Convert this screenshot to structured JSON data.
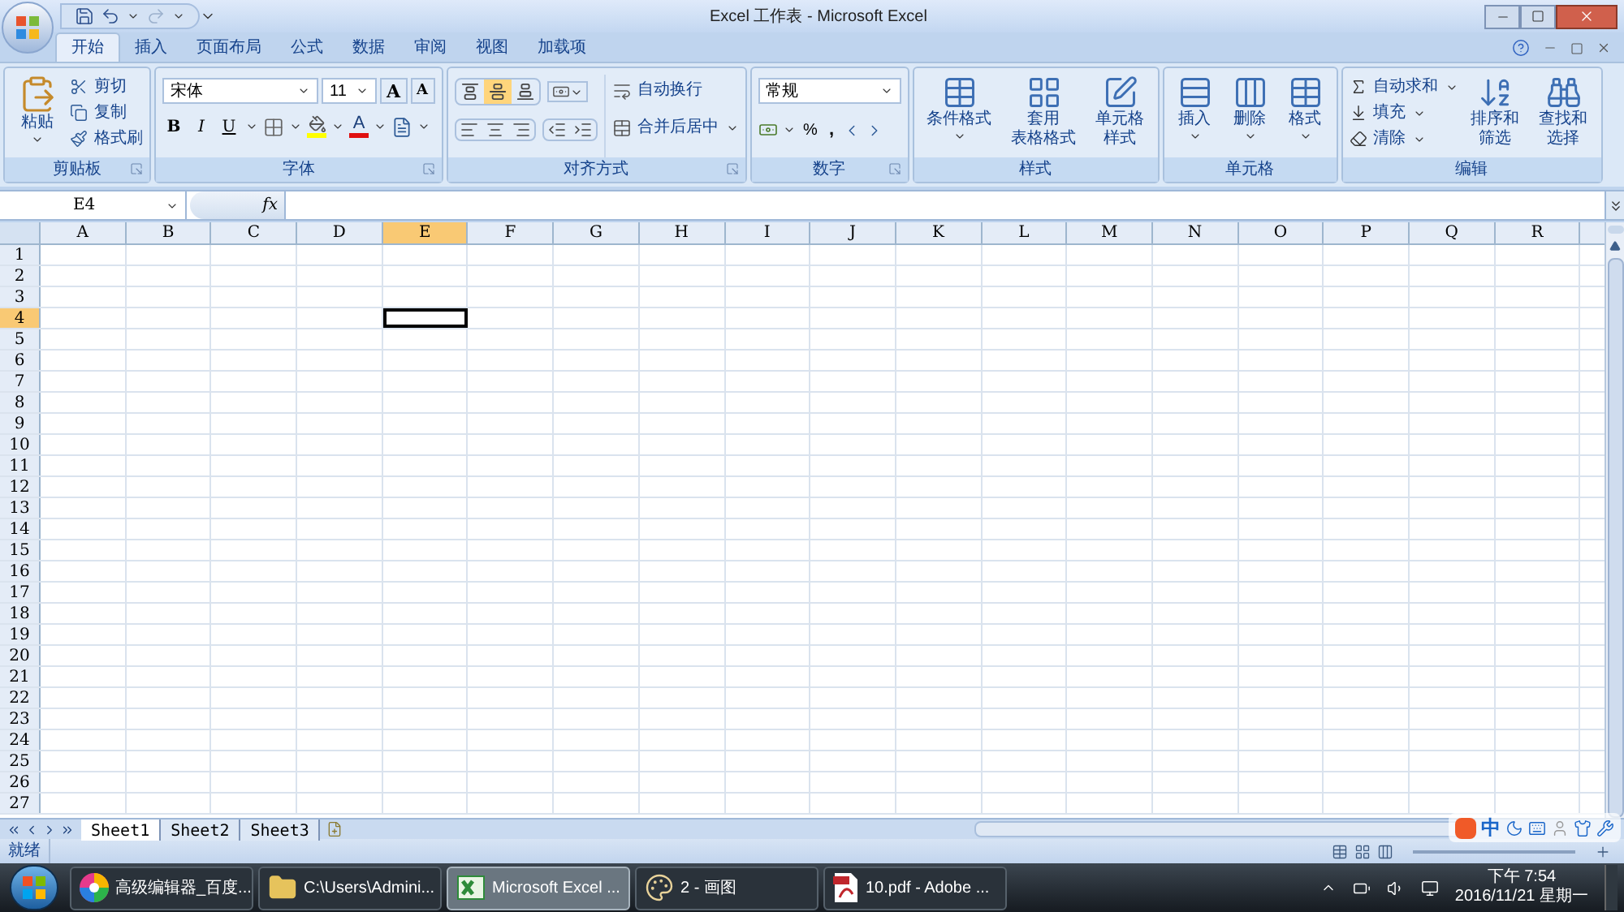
{
  "window": {
    "title": "Excel 工作表 - Microsoft Excel"
  },
  "tabs": [
    {
      "label": "开始",
      "selected": true
    },
    {
      "label": "插入",
      "selected": false
    },
    {
      "label": "页面布局",
      "selected": false
    },
    {
      "label": "公式",
      "selected": false
    },
    {
      "label": "数据",
      "selected": false
    },
    {
      "label": "审阅",
      "selected": false
    },
    {
      "label": "视图",
      "selected": false
    },
    {
      "label": "加载项",
      "selected": false
    }
  ],
  "ribbon": {
    "clipboard": {
      "label": "剪贴板",
      "paste": "粘贴",
      "small": [
        "剪切",
        "复制",
        "格式刷"
      ]
    },
    "font": {
      "label": "字体",
      "font_name": "宋体",
      "font_size": "11",
      "grow": "A",
      "shrink": "A",
      "styles": [
        "B",
        "I",
        "U"
      ],
      "font_color": "A"
    },
    "alignment": {
      "label": "对齐方式",
      "vertical": [
        {
          "selected": false
        },
        {
          "selected": true
        },
        {
          "selected": false
        }
      ],
      "wrap": "自动换行",
      "merge": "合并后居中"
    },
    "number": {
      "label": "数字",
      "format": "常规",
      "percent": "%",
      "comma": ","
    },
    "styles": {
      "label": "样式",
      "buttons": [
        {
          "lines": [
            "条件格式"
          ]
        },
        {
          "lines": [
            "套用",
            "表格格式"
          ]
        },
        {
          "lines": [
            "单元格",
            "样式"
          ]
        }
      ]
    },
    "cells": {
      "label": "单元格",
      "buttons": [
        "插入",
        "删除",
        "格式"
      ]
    },
    "editing": {
      "label": "编辑",
      "small": [
        "自动求和",
        "填充",
        "清除"
      ],
      "big": [
        {
          "lines": [
            "排序和",
            "筛选"
          ]
        },
        {
          "lines": [
            "查找和",
            "选择"
          ]
        }
      ]
    }
  },
  "formula_bar": {
    "name_box": "E4",
    "fx": "fx"
  },
  "grid": {
    "columns": [
      {
        "label": "A",
        "selected": false
      },
      {
        "label": "B",
        "selected": false
      },
      {
        "label": "C",
        "selected": false
      },
      {
        "label": "D",
        "selected": false
      },
      {
        "label": "E",
        "selected": true
      },
      {
        "label": "F",
        "selected": false
      },
      {
        "label": "G",
        "selected": false
      },
      {
        "label": "H",
        "selected": false
      },
      {
        "label": "I",
        "selected": false
      },
      {
        "label": "J",
        "selected": false
      },
      {
        "label": "K",
        "selected": false
      },
      {
        "label": "L",
        "selected": false
      },
      {
        "label": "M",
        "selected": false
      },
      {
        "label": "N",
        "selected": false
      },
      {
        "label": "O",
        "selected": false
      },
      {
        "label": "P",
        "selected": false
      },
      {
        "label": "Q",
        "selected": false
      },
      {
        "label": "R",
        "selected": false
      }
    ],
    "rows": [
      {
        "label": "1",
        "selected": false
      },
      {
        "label": "2",
        "selected": false
      },
      {
        "label": "3",
        "selected": false
      },
      {
        "label": "4",
        "selected": true
      },
      {
        "label": "5",
        "selected": false
      },
      {
        "label": "6",
        "selected": false
      },
      {
        "label": "7",
        "selected": false
      },
      {
        "label": "8",
        "selected": false
      },
      {
        "label": "9",
        "selected": false
      },
      {
        "label": "10",
        "selected": false
      },
      {
        "label": "11",
        "selected": false
      },
      {
        "label": "12",
        "selected": false
      },
      {
        "label": "13",
        "selected": false
      },
      {
        "label": "14",
        "selected": false
      },
      {
        "label": "15",
        "selected": false
      },
      {
        "label": "16",
        "selected": false
      },
      {
        "label": "17",
        "selected": false
      },
      {
        "label": "18",
        "selected": false
      },
      {
        "label": "19",
        "selected": false
      },
      {
        "label": "20",
        "selected": false
      },
      {
        "label": "21",
        "selected": false
      },
      {
        "label": "22",
        "selected": false
      },
      {
        "label": "23",
        "selected": false
      },
      {
        "label": "24",
        "selected": false
      },
      {
        "label": "25",
        "selected": false
      },
      {
        "label": "26",
        "selected": false
      },
      {
        "label": "27",
        "selected": false
      }
    ]
  },
  "sheet_tabs": [
    {
      "label": "Sheet1",
      "selected": true
    },
    {
      "label": "Sheet2",
      "selected": false
    },
    {
      "label": "Sheet3",
      "selected": false
    }
  ],
  "status_bar": {
    "text": "就绪"
  },
  "ime_bar": {
    "mode": "中"
  },
  "taskbar": {
    "items": [
      {
        "label": "高级编辑器_百度...",
        "kind": "pinwheel",
        "selected": false
      },
      {
        "label": "C:\\Users\\Admini...",
        "kind": "folder",
        "selected": false
      },
      {
        "label": "Microsoft Excel ...",
        "kind": "excel",
        "selected": true
      },
      {
        "label": "2 - 画图",
        "kind": "paint",
        "selected": false
      },
      {
        "label": "10.pdf - Adobe ...",
        "kind": "pdf",
        "selected": false
      }
    ],
    "clock": {
      "time": "下午 7:54",
      "date": "2016/11/21 星期一"
    }
  }
}
